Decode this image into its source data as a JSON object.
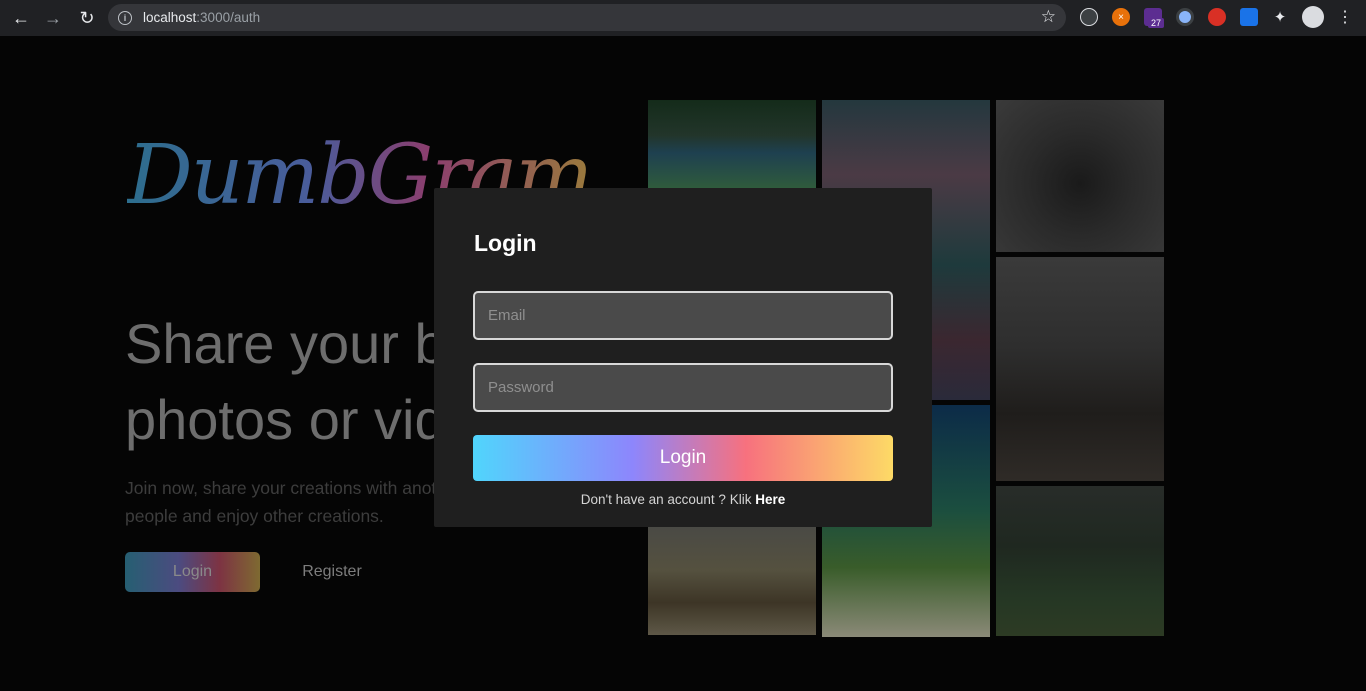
{
  "browser": {
    "url_host": "localhost",
    "url_path": ":3000/auth",
    "extension_badge": "27"
  },
  "hero": {
    "logo": "DumbGram",
    "headline_line1": "Share your best",
    "headline_line2": "photos or videos",
    "sub_line1": "Join now, share your creations with another",
    "sub_line2": "people and enjoy other creations.",
    "login_label": "Login",
    "register_label": "Register"
  },
  "modal": {
    "title": "Login",
    "email_placeholder": "Email",
    "password_placeholder": "Password",
    "submit_label": "Login",
    "switch_text": "Don't have an account ? Klik ",
    "switch_link": "Here"
  },
  "colors": {
    "page_bg": "#050505",
    "modal_bg": "#1f1f1f",
    "button_gradient": [
      "#50d5fc",
      "#8d86fc",
      "#f7717e",
      "#fdda66"
    ]
  }
}
